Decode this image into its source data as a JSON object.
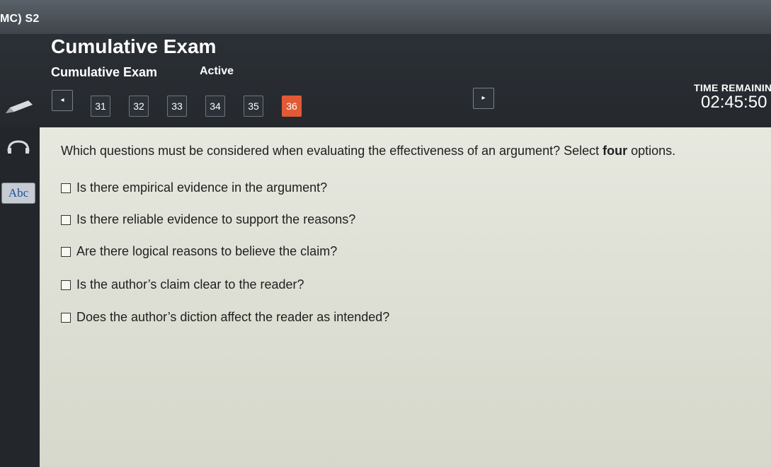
{
  "header": {
    "course": "MC) S2",
    "title": "Cumulative Exam",
    "subtitle": "Cumulative Exam",
    "status": "Active",
    "time_label": "TIME REMAININ",
    "time_value": "02:45:50"
  },
  "nav": {
    "prev_icon": "◂",
    "next_icon": "▸",
    "questions": [
      "31",
      "32",
      "33",
      "34",
      "35",
      "36"
    ],
    "active_index": 5
  },
  "sidebar": {
    "abc_label": "Abc"
  },
  "question": {
    "prefix": "Which questions must be considered when evaluating the effectiveness of an argument? Select ",
    "emphasis": "four",
    "suffix": " options.",
    "options": [
      "Is there empirical evidence in the argument?",
      "Is there reliable evidence to support the reasons?",
      "Are there logical reasons to believe the claim?",
      "Is the author’s claim clear to the reader?",
      "Does the author’s diction affect the reader as intended?"
    ]
  },
  "colors": {
    "active_question": "#e15a36",
    "content_bg": "#e7e8df"
  }
}
